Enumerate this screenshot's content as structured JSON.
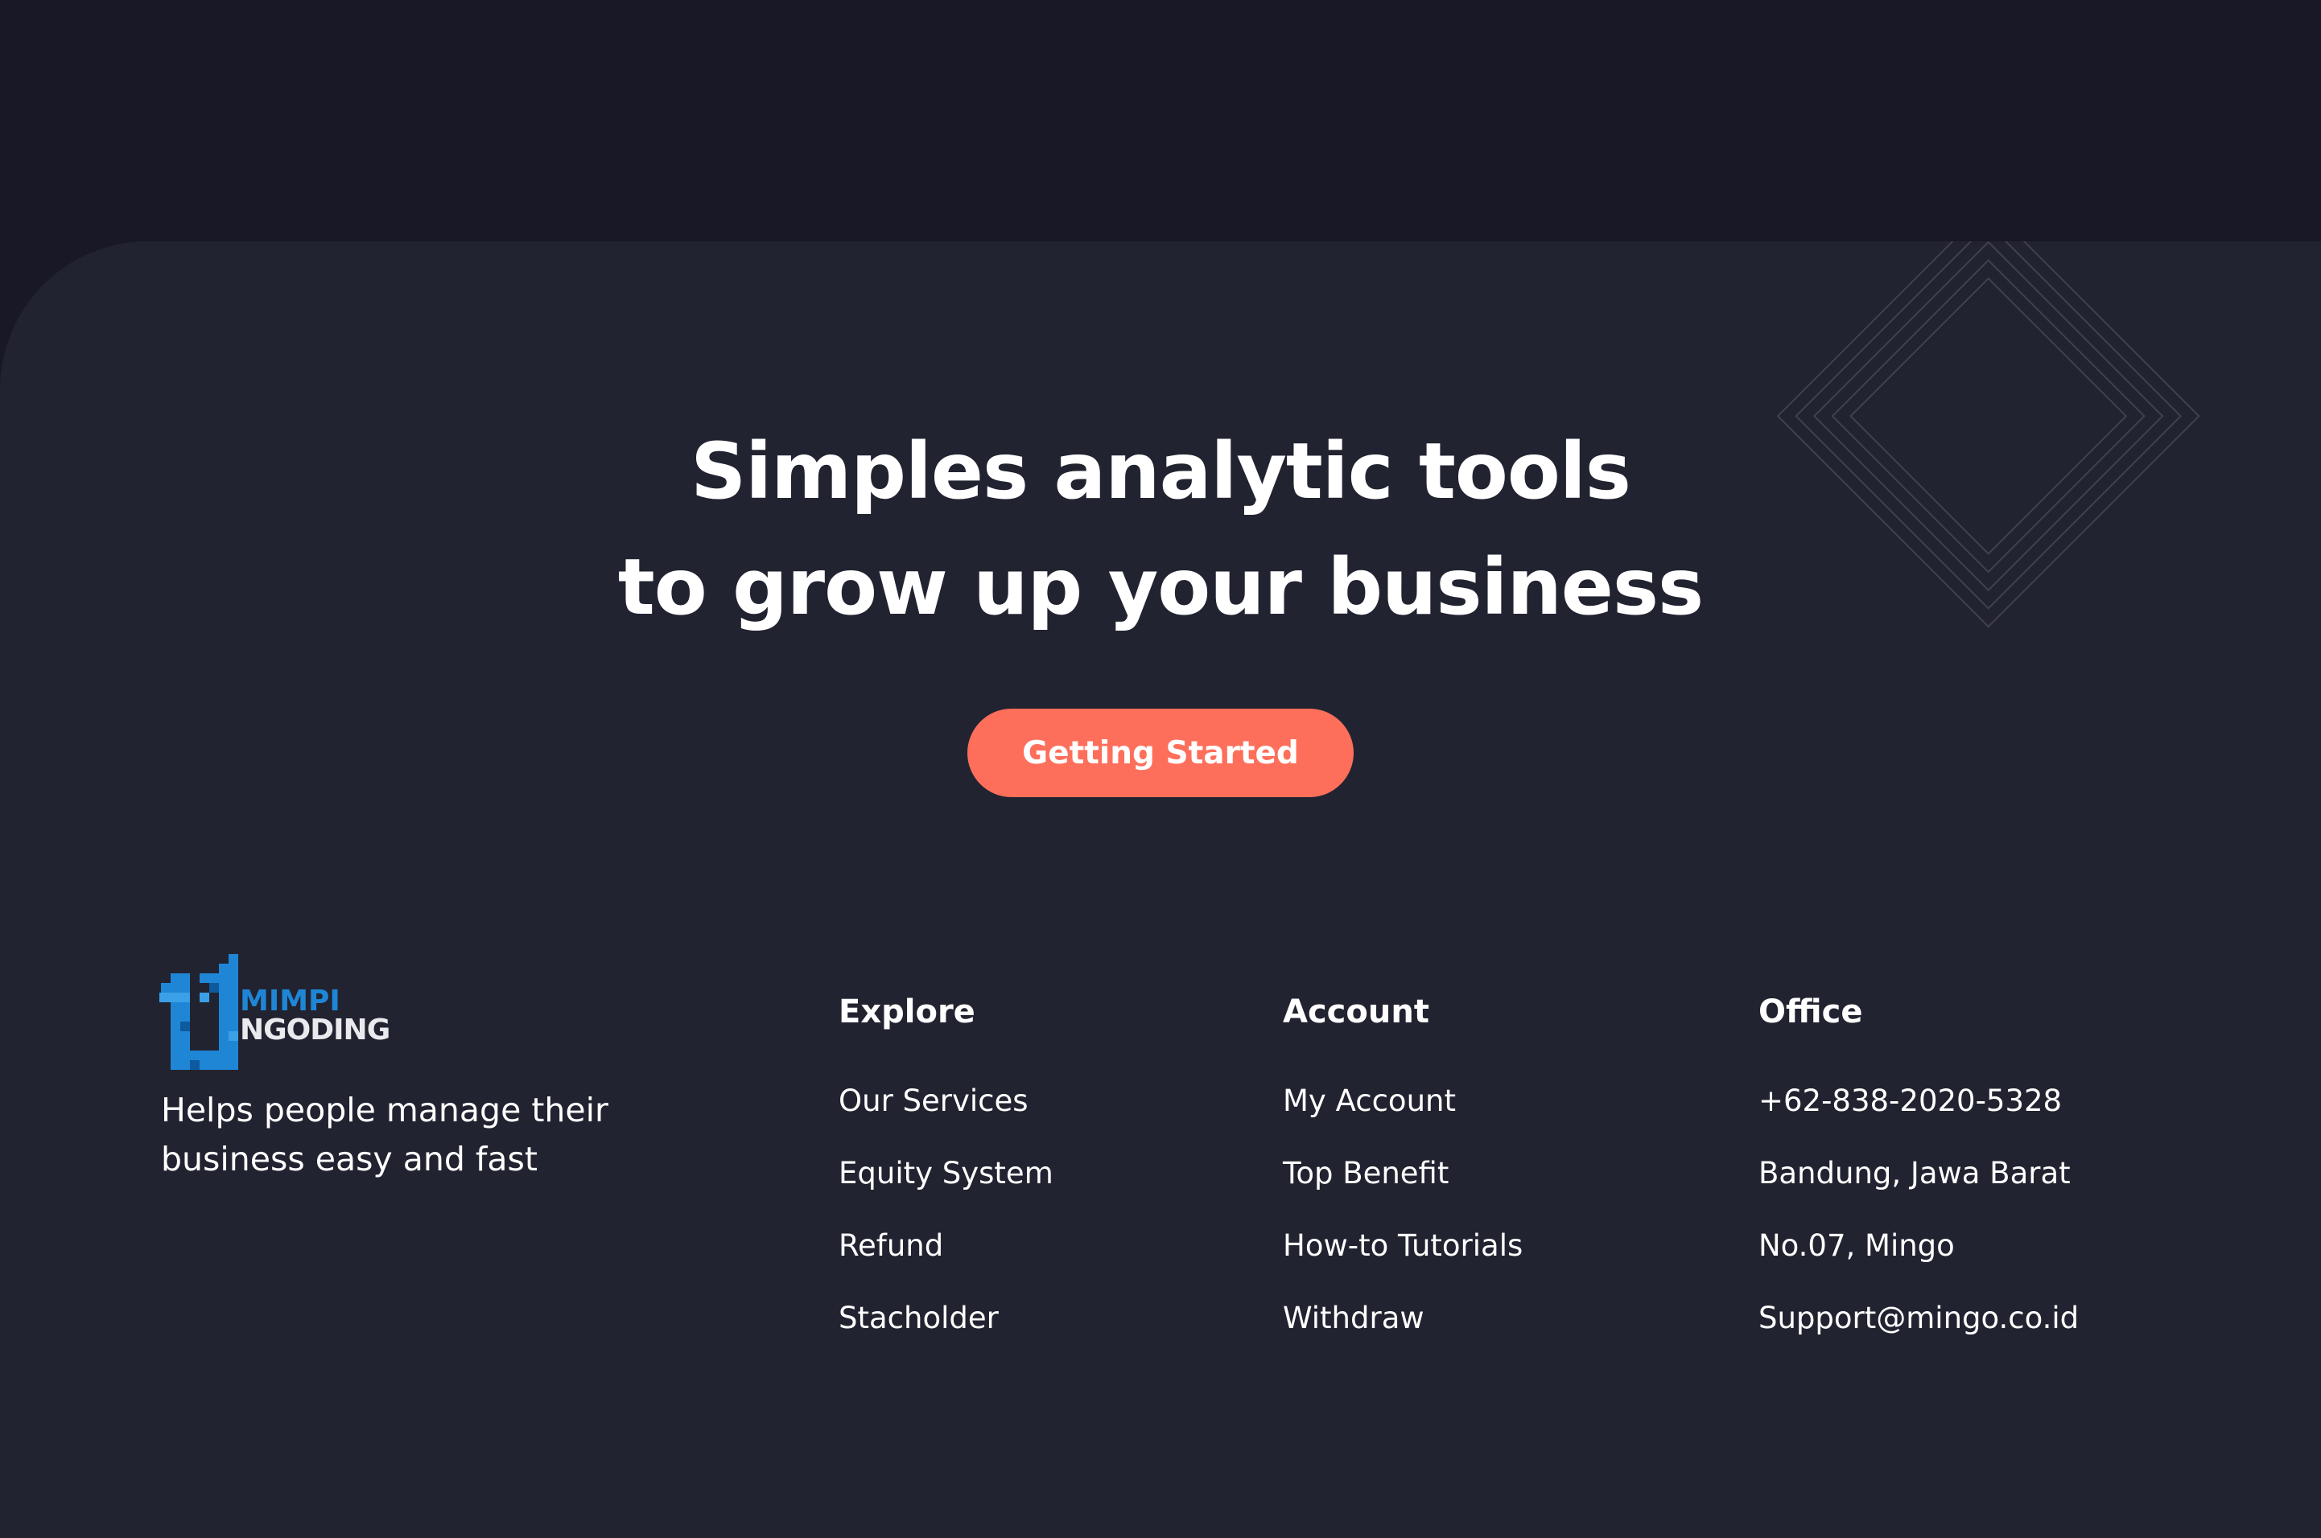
{
  "hero": {
    "title_line1": "Simples analytic tools",
    "title_line2": "to grow up your business",
    "cta_label": "Getting Started"
  },
  "brand": {
    "logo_line1": "MIMPI",
    "logo_line2": "NGODING",
    "tagline_line1": "Helps people manage their",
    "tagline_line2": "business easy and fast"
  },
  "footer": {
    "explore": {
      "heading": "Explore",
      "items": [
        "Our Services",
        "Equity System",
        "Refund",
        "Stacholder"
      ]
    },
    "account": {
      "heading": "Account",
      "items": [
        "My Account",
        "Top Benefit",
        "How-to Tutorials",
        "Withdraw"
      ]
    },
    "office": {
      "heading": "Office",
      "items": [
        "+62-838-2020-5328",
        "Bandung, Jawa Barat",
        "No.07, Mingo",
        "Support@mingo.co.id"
      ]
    }
  },
  "colors": {
    "page_background": "#181826",
    "panel_background": "#222330",
    "accent": "#fd6f5b",
    "logo_blue": "#1f86d6",
    "text": "#ffffff"
  },
  "icons": [
    "diamond-lines-decoration",
    "mimpi-ngoding-logo"
  ]
}
